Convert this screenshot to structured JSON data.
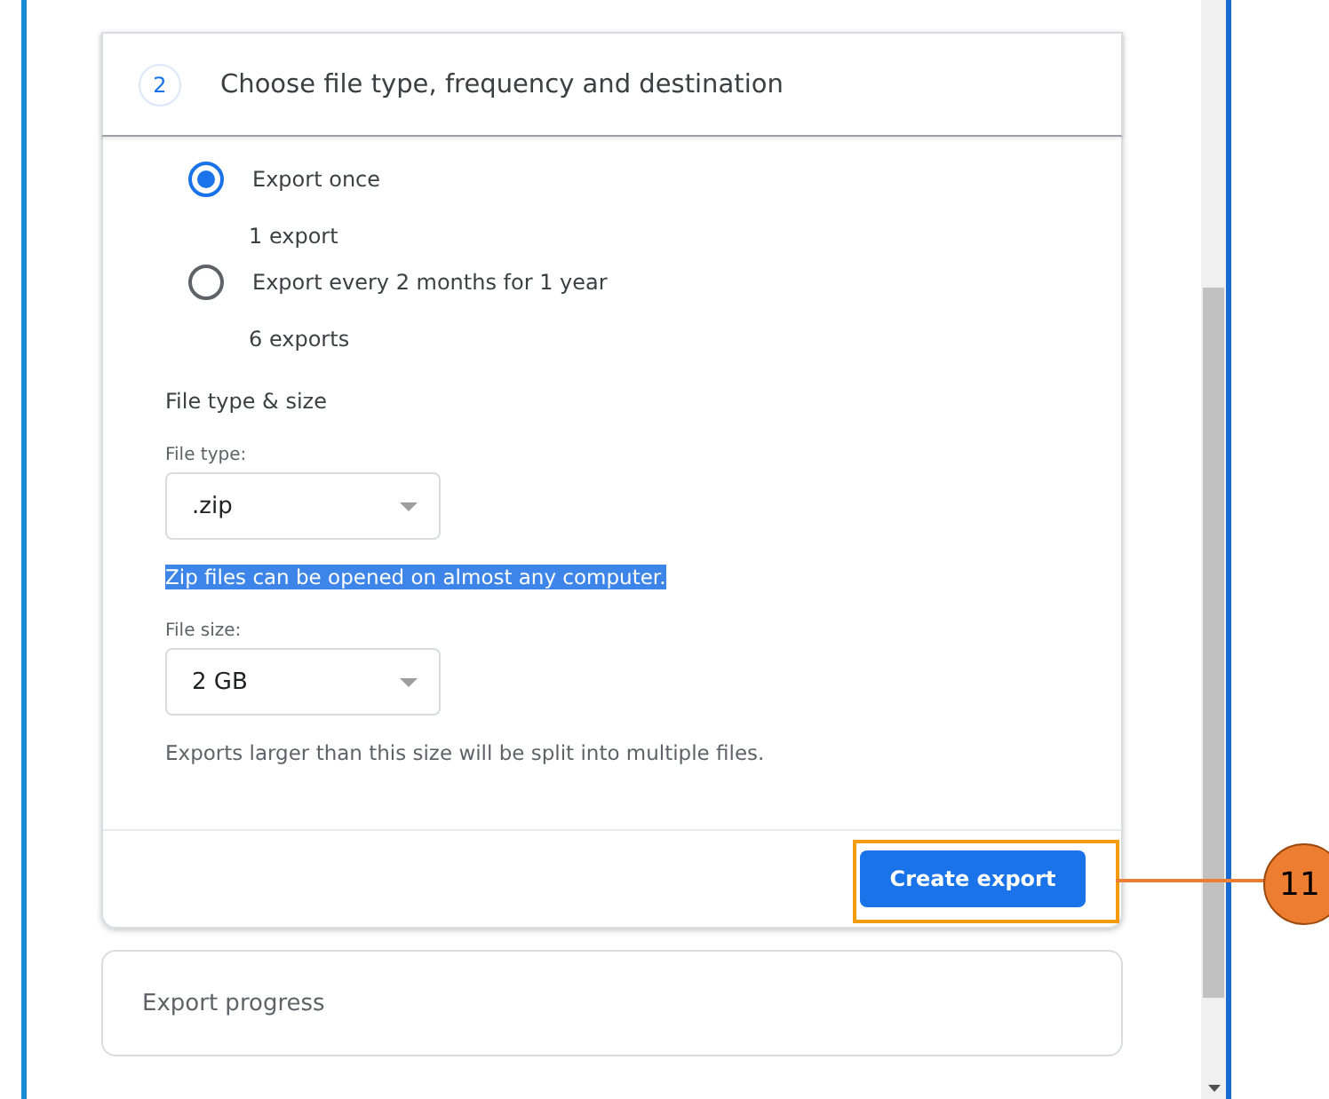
{
  "step": {
    "number": "2",
    "title": "Choose file type, frequency and destination"
  },
  "frequency_options": [
    {
      "label": "Export once",
      "detail": "1 export",
      "selected": true
    },
    {
      "label": "Export every 2 months for 1 year",
      "detail": "6 exports",
      "selected": false
    }
  ],
  "file_type_size": {
    "heading": "File type & size",
    "fields": [
      {
        "label": "File type:",
        "value": ".zip",
        "note": "Zip files can be opened on almost any computer.",
        "note_highlighted": true
      },
      {
        "label": "File size:",
        "value": "2 GB",
        "note": "Exports larger than this size will be split into multiple files.",
        "note_highlighted": false
      }
    ]
  },
  "create_button": {
    "label": "Create export"
  },
  "export_progress": {
    "title": "Export progress"
  },
  "callout": {
    "number": "11"
  }
}
